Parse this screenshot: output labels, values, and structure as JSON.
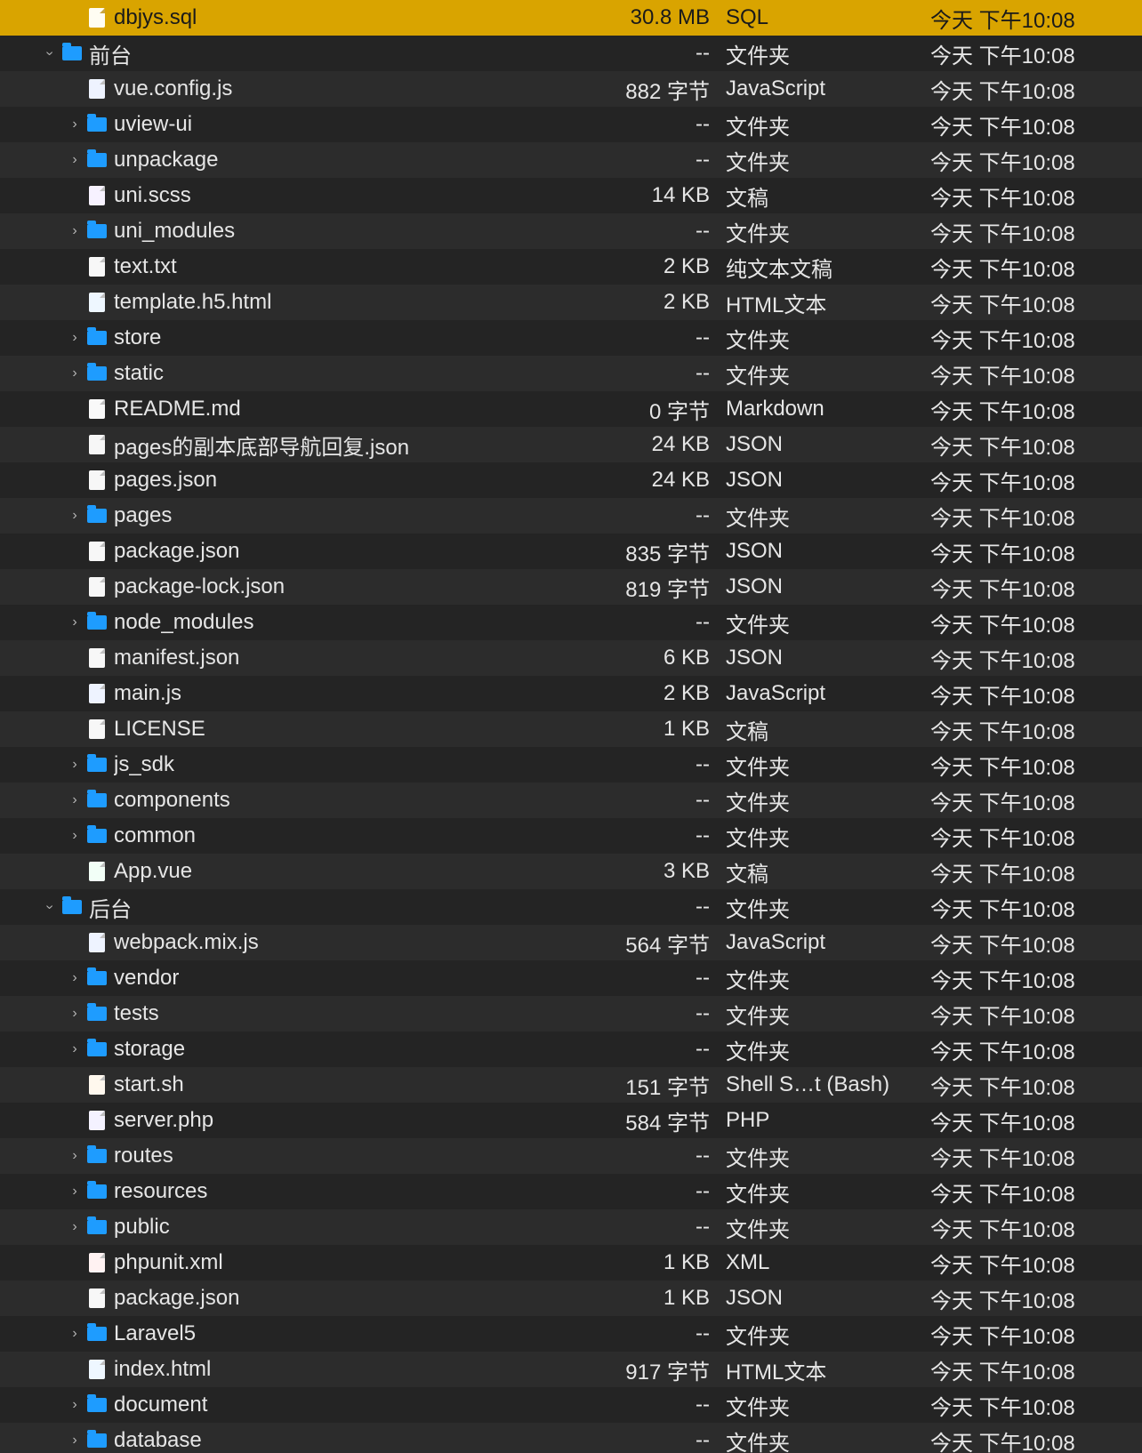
{
  "rows": [
    {
      "indent": 1,
      "disclosure": "",
      "icon": "file",
      "ft": "sql",
      "name": "dbjys.sql",
      "size": "30.8 MB",
      "kind": "SQL",
      "date": "今天 下午10:08",
      "selected": true
    },
    {
      "indent": 0,
      "disclosure": "down",
      "icon": "folder",
      "ft": "",
      "name": "前台",
      "size": "--",
      "kind": "文件夹",
      "date": "今天 下午10:08",
      "selected": false
    },
    {
      "indent": 1,
      "disclosure": "",
      "icon": "file",
      "ft": "js",
      "name": "vue.config.js",
      "size": "882 字节",
      "kind": "JavaScript",
      "date": "今天 下午10:08",
      "selected": false
    },
    {
      "indent": 1,
      "disclosure": "right",
      "icon": "folder",
      "ft": "",
      "name": "uview-ui",
      "size": "--",
      "kind": "文件夹",
      "date": "今天 下午10:08",
      "selected": false
    },
    {
      "indent": 1,
      "disclosure": "right",
      "icon": "folder",
      "ft": "",
      "name": "unpackage",
      "size": "--",
      "kind": "文件夹",
      "date": "今天 下午10:08",
      "selected": false
    },
    {
      "indent": 1,
      "disclosure": "",
      "icon": "file",
      "ft": "scss",
      "name": "uni.scss",
      "size": "14 KB",
      "kind": "文稿",
      "date": "今天 下午10:08",
      "selected": false
    },
    {
      "indent": 1,
      "disclosure": "right",
      "icon": "folder",
      "ft": "",
      "name": "uni_modules",
      "size": "--",
      "kind": "文件夹",
      "date": "今天 下午10:08",
      "selected": false
    },
    {
      "indent": 1,
      "disclosure": "",
      "icon": "file",
      "ft": "txt",
      "name": "text.txt",
      "size": "2 KB",
      "kind": "纯文本文稿",
      "date": "今天 下午10:08",
      "selected": false
    },
    {
      "indent": 1,
      "disclosure": "",
      "icon": "file",
      "ft": "html",
      "name": "template.h5.html",
      "size": "2 KB",
      "kind": "HTML文本",
      "date": "今天 下午10:08",
      "selected": false
    },
    {
      "indent": 1,
      "disclosure": "right",
      "icon": "folder",
      "ft": "",
      "name": "store",
      "size": "--",
      "kind": "文件夹",
      "date": "今天 下午10:08",
      "selected": false
    },
    {
      "indent": 1,
      "disclosure": "right",
      "icon": "folder",
      "ft": "",
      "name": "static",
      "size": "--",
      "kind": "文件夹",
      "date": "今天 下午10:08",
      "selected": false
    },
    {
      "indent": 1,
      "disclosure": "",
      "icon": "file",
      "ft": "md",
      "name": "README.md",
      "size": "0 字节",
      "kind": "Markdown",
      "date": "今天 下午10:08",
      "selected": false
    },
    {
      "indent": 1,
      "disclosure": "",
      "icon": "file",
      "ft": "json",
      "name": "pages的副本底部导航回复.json",
      "size": "24 KB",
      "kind": "JSON",
      "date": "今天 下午10:08",
      "selected": false
    },
    {
      "indent": 1,
      "disclosure": "",
      "icon": "file",
      "ft": "json",
      "name": "pages.json",
      "size": "24 KB",
      "kind": "JSON",
      "date": "今天 下午10:08",
      "selected": false
    },
    {
      "indent": 1,
      "disclosure": "right",
      "icon": "folder",
      "ft": "",
      "name": "pages",
      "size": "--",
      "kind": "文件夹",
      "date": "今天 下午10:08",
      "selected": false
    },
    {
      "indent": 1,
      "disclosure": "",
      "icon": "file",
      "ft": "json",
      "name": "package.json",
      "size": "835 字节",
      "kind": "JSON",
      "date": "今天 下午10:08",
      "selected": false
    },
    {
      "indent": 1,
      "disclosure": "",
      "icon": "file",
      "ft": "json",
      "name": "package-lock.json",
      "size": "819 字节",
      "kind": "JSON",
      "date": "今天 下午10:08",
      "selected": false
    },
    {
      "indent": 1,
      "disclosure": "right",
      "icon": "folder",
      "ft": "",
      "name": "node_modules",
      "size": "--",
      "kind": "文件夹",
      "date": "今天 下午10:08",
      "selected": false
    },
    {
      "indent": 1,
      "disclosure": "",
      "icon": "file",
      "ft": "json",
      "name": "manifest.json",
      "size": "6 KB",
      "kind": "JSON",
      "date": "今天 下午10:08",
      "selected": false
    },
    {
      "indent": 1,
      "disclosure": "",
      "icon": "file",
      "ft": "js",
      "name": "main.js",
      "size": "2 KB",
      "kind": "JavaScript",
      "date": "今天 下午10:08",
      "selected": false
    },
    {
      "indent": 1,
      "disclosure": "",
      "icon": "file",
      "ft": "plain",
      "name": "LICENSE",
      "size": "1 KB",
      "kind": "文稿",
      "date": "今天 下午10:08",
      "selected": false
    },
    {
      "indent": 1,
      "disclosure": "right",
      "icon": "folder",
      "ft": "",
      "name": "js_sdk",
      "size": "--",
      "kind": "文件夹",
      "date": "今天 下午10:08",
      "selected": false
    },
    {
      "indent": 1,
      "disclosure": "right",
      "icon": "folder",
      "ft": "",
      "name": "components",
      "size": "--",
      "kind": "文件夹",
      "date": "今天 下午10:08",
      "selected": false
    },
    {
      "indent": 1,
      "disclosure": "right",
      "icon": "folder",
      "ft": "",
      "name": "common",
      "size": "--",
      "kind": "文件夹",
      "date": "今天 下午10:08",
      "selected": false
    },
    {
      "indent": 1,
      "disclosure": "",
      "icon": "file",
      "ft": "vue",
      "name": "App.vue",
      "size": "3 KB",
      "kind": "文稿",
      "date": "今天 下午10:08",
      "selected": false
    },
    {
      "indent": 0,
      "disclosure": "down",
      "icon": "folder",
      "ft": "",
      "name": "后台",
      "size": "--",
      "kind": "文件夹",
      "date": "今天 下午10:08",
      "selected": false
    },
    {
      "indent": 1,
      "disclosure": "",
      "icon": "file",
      "ft": "js",
      "name": "webpack.mix.js",
      "size": "564 字节",
      "kind": "JavaScript",
      "date": "今天 下午10:08",
      "selected": false
    },
    {
      "indent": 1,
      "disclosure": "right",
      "icon": "folder",
      "ft": "",
      "name": "vendor",
      "size": "--",
      "kind": "文件夹",
      "date": "今天 下午10:08",
      "selected": false
    },
    {
      "indent": 1,
      "disclosure": "right",
      "icon": "folder",
      "ft": "",
      "name": "tests",
      "size": "--",
      "kind": "文件夹",
      "date": "今天 下午10:08",
      "selected": false
    },
    {
      "indent": 1,
      "disclosure": "right",
      "icon": "folder",
      "ft": "",
      "name": "storage",
      "size": "--",
      "kind": "文件夹",
      "date": "今天 下午10:08",
      "selected": false
    },
    {
      "indent": 1,
      "disclosure": "",
      "icon": "file",
      "ft": "sh",
      "name": "start.sh",
      "size": "151 字节",
      "kind": "Shell S…t (Bash)",
      "date": "今天 下午10:08",
      "selected": false
    },
    {
      "indent": 1,
      "disclosure": "",
      "icon": "file",
      "ft": "php",
      "name": "server.php",
      "size": "584 字节",
      "kind": "PHP",
      "date": "今天 下午10:08",
      "selected": false
    },
    {
      "indent": 1,
      "disclosure": "right",
      "icon": "folder",
      "ft": "",
      "name": "routes",
      "size": "--",
      "kind": "文件夹",
      "date": "今天 下午10:08",
      "selected": false
    },
    {
      "indent": 1,
      "disclosure": "right",
      "icon": "folder",
      "ft": "",
      "name": "resources",
      "size": "--",
      "kind": "文件夹",
      "date": "今天 下午10:08",
      "selected": false
    },
    {
      "indent": 1,
      "disclosure": "right",
      "icon": "folder",
      "ft": "",
      "name": "public",
      "size": "--",
      "kind": "文件夹",
      "date": "今天 下午10:08",
      "selected": false
    },
    {
      "indent": 1,
      "disclosure": "",
      "icon": "file",
      "ft": "xml",
      "name": "phpunit.xml",
      "size": "1 KB",
      "kind": "XML",
      "date": "今天 下午10:08",
      "selected": false
    },
    {
      "indent": 1,
      "disclosure": "",
      "icon": "file",
      "ft": "json",
      "name": "package.json",
      "size": "1 KB",
      "kind": "JSON",
      "date": "今天 下午10:08",
      "selected": false
    },
    {
      "indent": 1,
      "disclosure": "right",
      "icon": "folder",
      "ft": "",
      "name": "Laravel5",
      "size": "--",
      "kind": "文件夹",
      "date": "今天 下午10:08",
      "selected": false
    },
    {
      "indent": 1,
      "disclosure": "",
      "icon": "file",
      "ft": "html",
      "name": "index.html",
      "size": "917 字节",
      "kind": "HTML文本",
      "date": "今天 下午10:08",
      "selected": false
    },
    {
      "indent": 1,
      "disclosure": "right",
      "icon": "folder",
      "ft": "",
      "name": "document",
      "size": "--",
      "kind": "文件夹",
      "date": "今天 下午10:08",
      "selected": false
    },
    {
      "indent": 1,
      "disclosure": "right",
      "icon": "folder",
      "ft": "",
      "name": "database",
      "size": "--",
      "kind": "文件夹",
      "date": "今天 下午10:08",
      "selected": false
    }
  ]
}
